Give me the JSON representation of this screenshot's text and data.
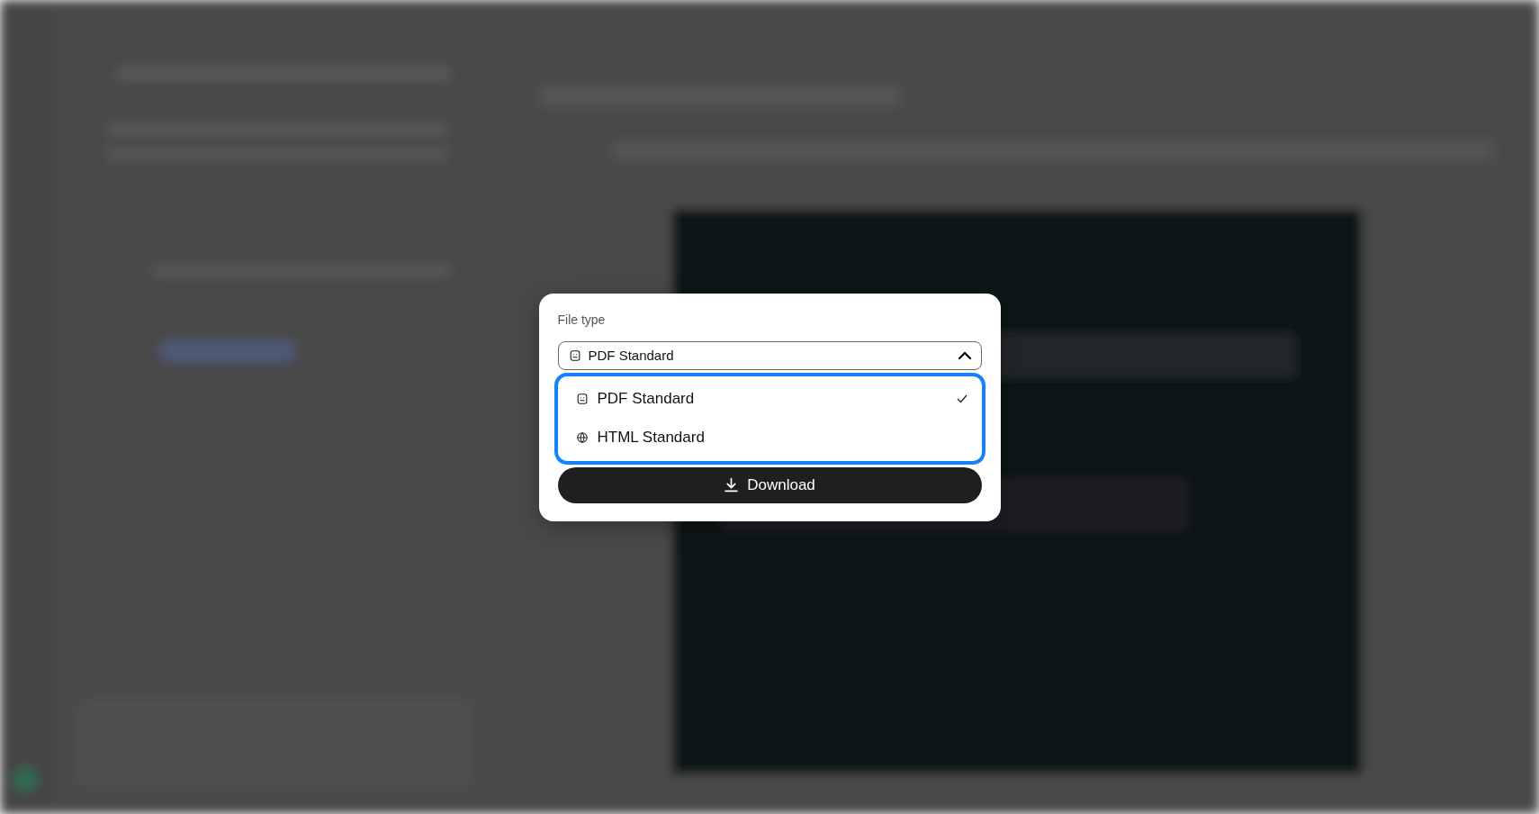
{
  "dialog": {
    "label": "File type",
    "select": {
      "value": "PDF Standard",
      "kind": "document",
      "expanded": true
    },
    "options": [
      {
        "label": "PDF Standard",
        "kind": "document",
        "selected": true
      },
      {
        "label": "HTML Standard",
        "kind": "web",
        "selected": false
      }
    ],
    "button": {
      "label": "Download"
    }
  }
}
